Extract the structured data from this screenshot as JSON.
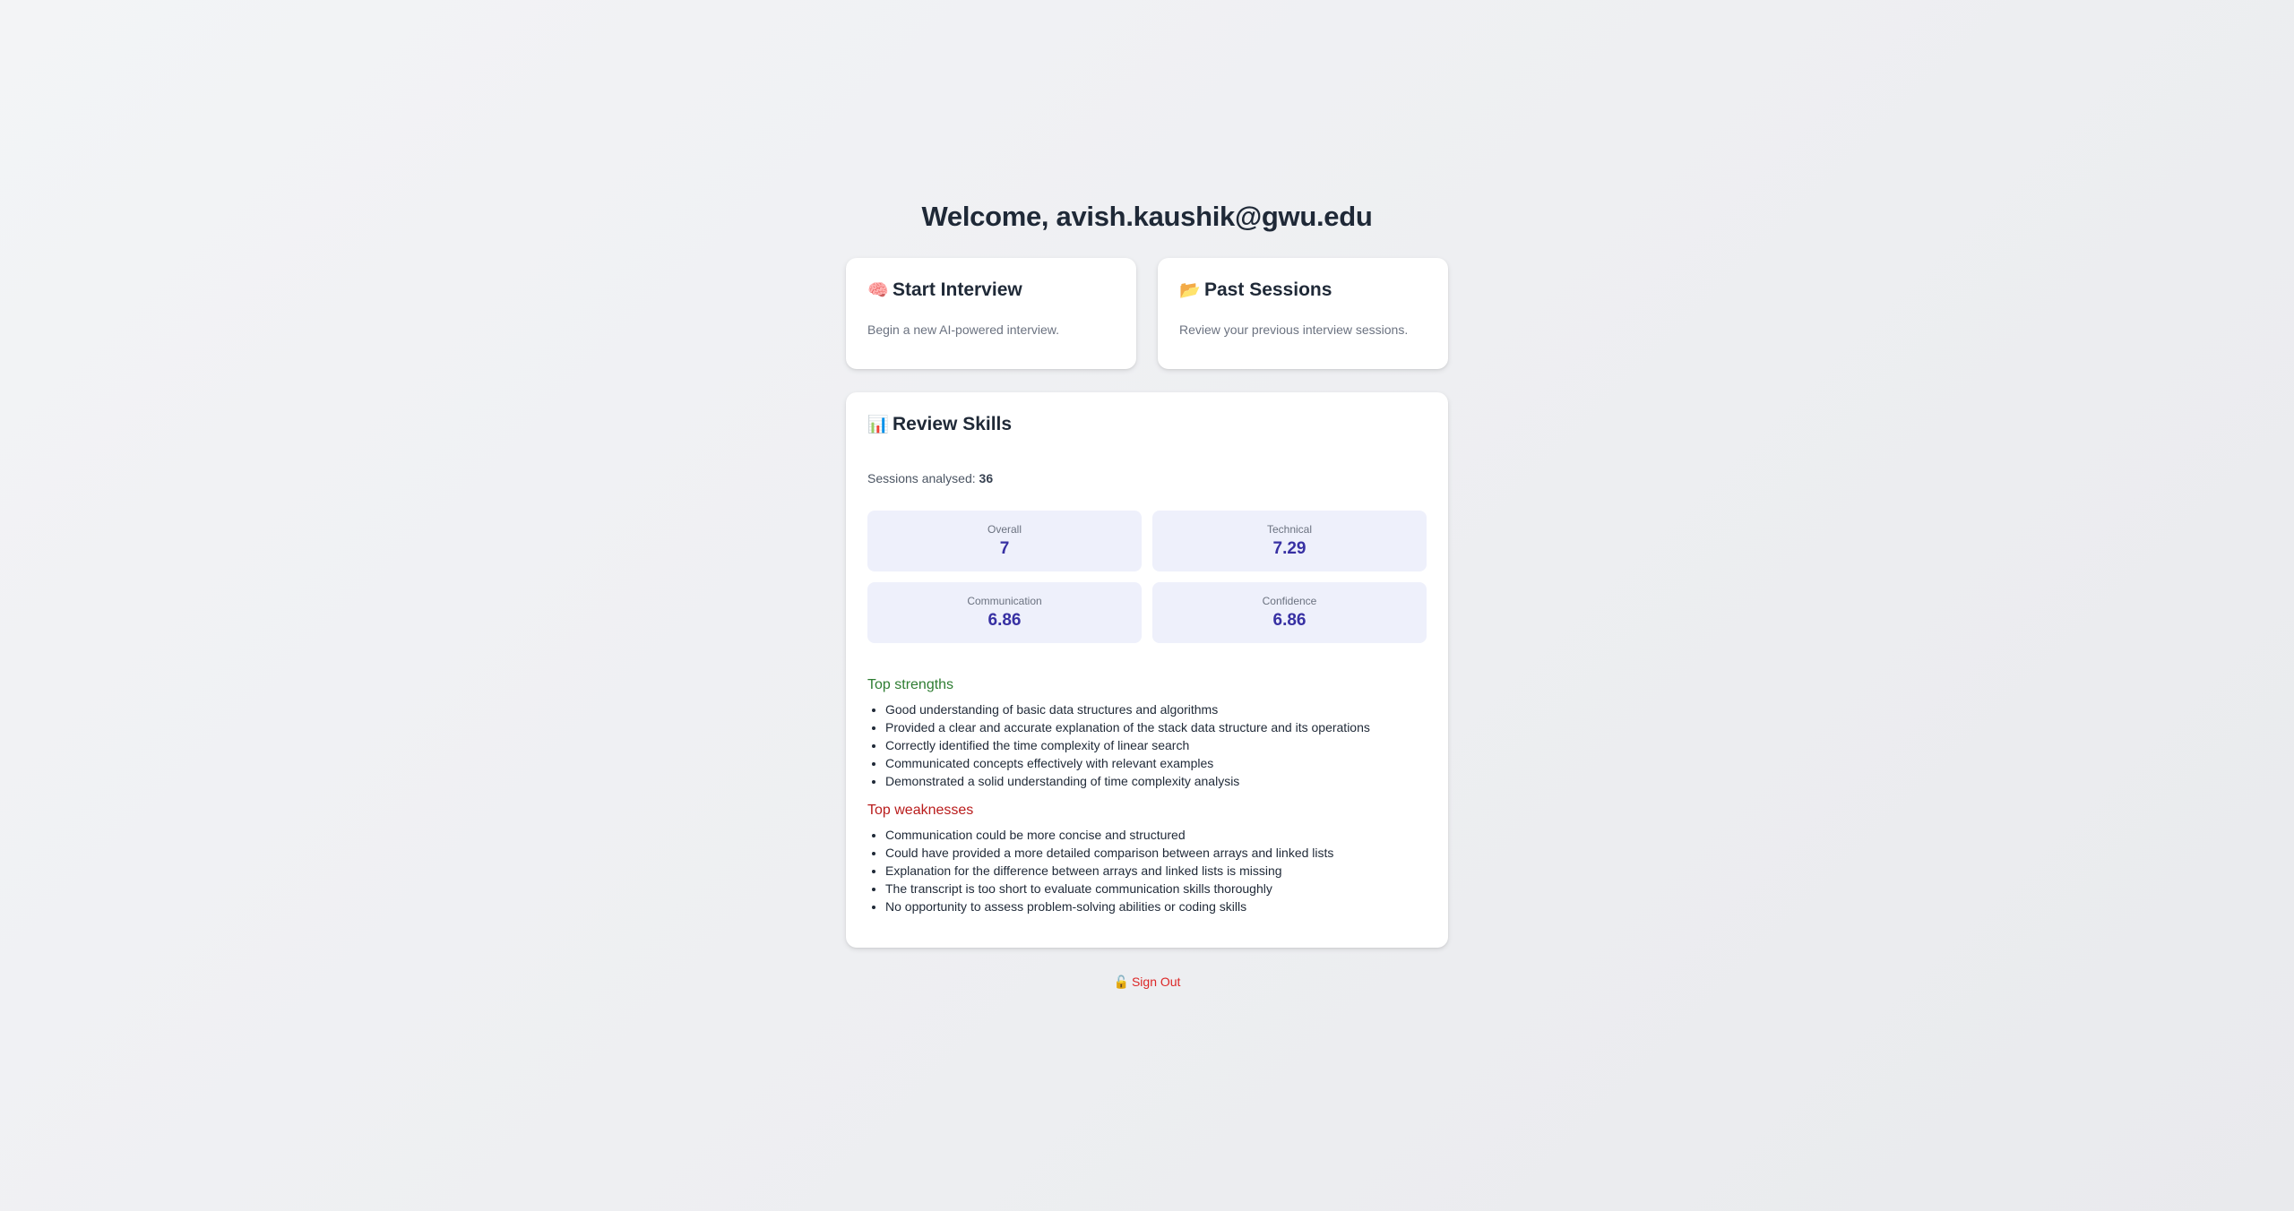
{
  "header": {
    "title": "Welcome, avish.kaushik@gwu.edu"
  },
  "cards": {
    "start": {
      "icon": "🧠",
      "icon_name": "brain-icon",
      "title": "Start Interview",
      "description": "Begin a new AI-powered interview."
    },
    "past": {
      "icon": "📂",
      "icon_name": "folder-icon",
      "title": "Past Sessions",
      "description": "Review your previous interview sessions."
    }
  },
  "review": {
    "icon": "📊",
    "icon_name": "bar-chart-icon",
    "title": "Review Skills",
    "analysed_label": "Sessions analysed:",
    "analysed_count": "36",
    "metrics": [
      {
        "label": "Overall",
        "value": "7"
      },
      {
        "label": "Technical",
        "value": "7.29"
      },
      {
        "label": "Communication",
        "value": "6.86"
      },
      {
        "label": "Confidence",
        "value": "6.86"
      }
    ],
    "strengths_title": "Top strengths",
    "strengths": [
      "Good understanding of basic data structures and algorithms",
      "Provided a clear and accurate explanation of the stack data structure and its operations",
      "Correctly identified the time complexity of linear search",
      "Communicated concepts effectively with relevant examples",
      "Demonstrated a solid understanding of time complexity analysis"
    ],
    "weaknesses_title": "Top weaknesses",
    "weaknesses": [
      "Communication could be more concise and structured",
      "Could have provided a more detailed comparison between arrays and linked lists",
      "Explanation for the difference between arrays and linked lists is missing",
      "The transcript is too short to evaluate communication skills thoroughly",
      "No opportunity to assess problem-solving abilities or coding skills"
    ]
  },
  "signout": {
    "icon": "🔓",
    "icon_name": "unlock-icon",
    "label": "Sign Out"
  },
  "colors": {
    "accent": "#3730a3",
    "strength": "#2e7d32",
    "weakness": "#b91c1c",
    "signout": "#dc2626",
    "metric_bg": "#eef0fb"
  }
}
